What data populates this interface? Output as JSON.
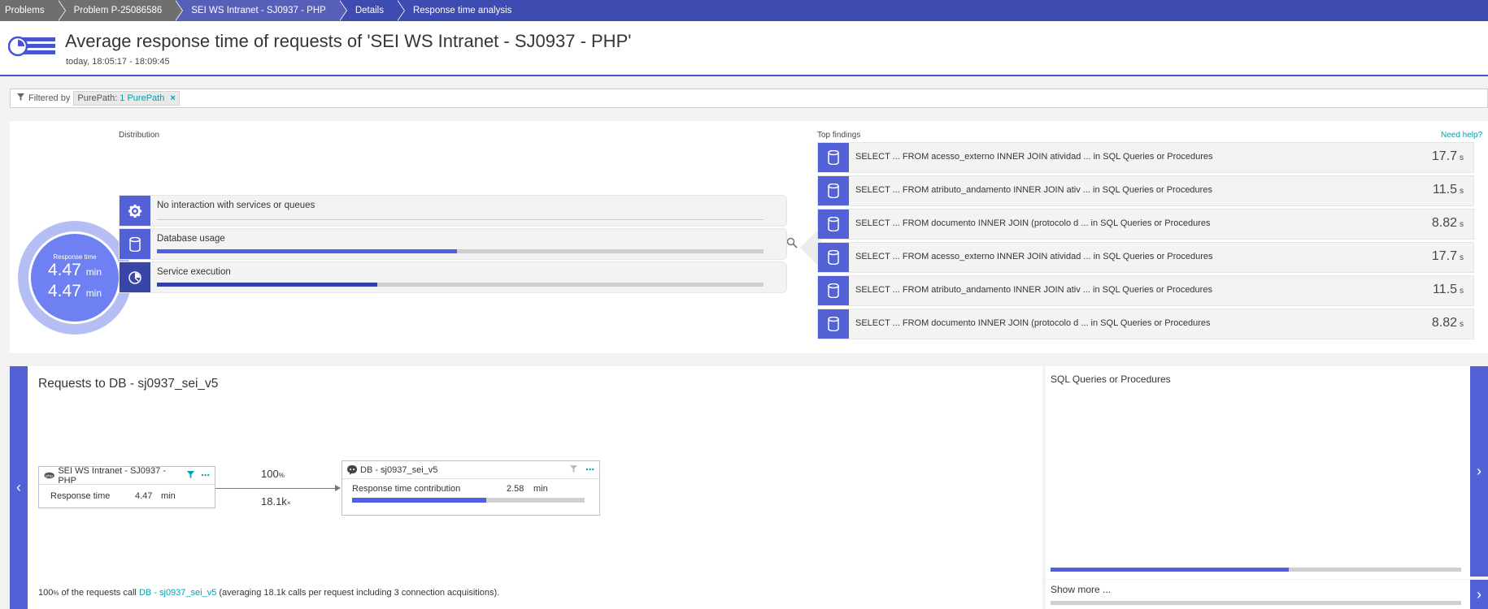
{
  "breadcrumb": [
    "Problems",
    "Problem P-25086586",
    "SEI WS Intranet - SJ0937 - PHP",
    "Details",
    "Response time analysis"
  ],
  "header": {
    "title": "Average response time of requests of 'SEI WS Intranet - SJ0937 - PHP'",
    "subtitle": "today, 18:05:17 - 18:09:45"
  },
  "filter": {
    "label": "Filtered by",
    "chip_key": "PurePath:",
    "chip_value": "1 PurePath",
    "remove": "×"
  },
  "distribution": {
    "label": "Distribution",
    "ring_label": "Response time",
    "value1": "4.47",
    "value2": "4.47",
    "unit": "min",
    "rows": [
      {
        "name": "No interaction with services or queues",
        "icon": "gear-icon",
        "fraction": 0
      },
      {
        "name": "Database usage",
        "icon": "database-icon",
        "fraction": 0.495
      },
      {
        "name": "Service execution",
        "icon": "service-execution-icon",
        "fraction": 0.363
      }
    ]
  },
  "findings": {
    "label": "Top findings",
    "help": "Need help?",
    "items": [
      {
        "text": "SELECT ... FROM acesso_externo INNER JOIN atividad ... in SQL Queries or Procedures",
        "value": "17.7",
        "unit": "s"
      },
      {
        "text": "SELECT ... FROM atributo_andamento INNER JOIN ativ ... in SQL Queries or Procedures",
        "value": "11.5",
        "unit": "s"
      },
      {
        "text": "SELECT ... FROM documento INNER JOIN (protocolo d ... in SQL Queries or Procedures",
        "value": "8.82",
        "unit": "s"
      },
      {
        "text": "SELECT ... FROM acesso_externo INNER JOIN atividad ... in SQL Queries or Procedures",
        "value": "17.7",
        "unit": "s"
      },
      {
        "text": "SELECT ... FROM atributo_andamento INNER JOIN ativ ... in SQL Queries or Procedures",
        "value": "11.5",
        "unit": "s"
      },
      {
        "text": "SELECT ... FROM documento INNER JOIN (protocolo d ... in SQL Queries or Procedures",
        "value": "8.82",
        "unit": "s"
      }
    ]
  },
  "requests": {
    "title": "Requests to DB - sj0937_sei_v5",
    "source": {
      "name": "SEI WS Intranet - SJ0937 - PHP",
      "metric": "Response time",
      "value": "4.47",
      "unit": "min"
    },
    "target": {
      "name": "DB - sj0937_sei_v5",
      "metric": "Response time contribution",
      "value": "2.58",
      "unit": "min",
      "fraction": 0.578
    },
    "percent": "100",
    "percent_unit": "%",
    "calls": "18.1k",
    "calls_unit": "×",
    "footer_pct": "100",
    "footer_pct_unit": "%",
    "footer_pre": " of the requests call ",
    "footer_link": "DB - sj0937_sei_v5",
    "footer_post": " (averaging 18.1k calls per request including 3 connection acquisitions)."
  },
  "sql_panel": {
    "title": "SQL Queries or Procedures",
    "fraction": 0.58,
    "show_more": "Show more ..."
  },
  "colors": {
    "accent": "#5261d6",
    "bar": "#4f5fe8",
    "link": "#00a1b2",
    "breadcrumb": "#3e4bb0"
  }
}
